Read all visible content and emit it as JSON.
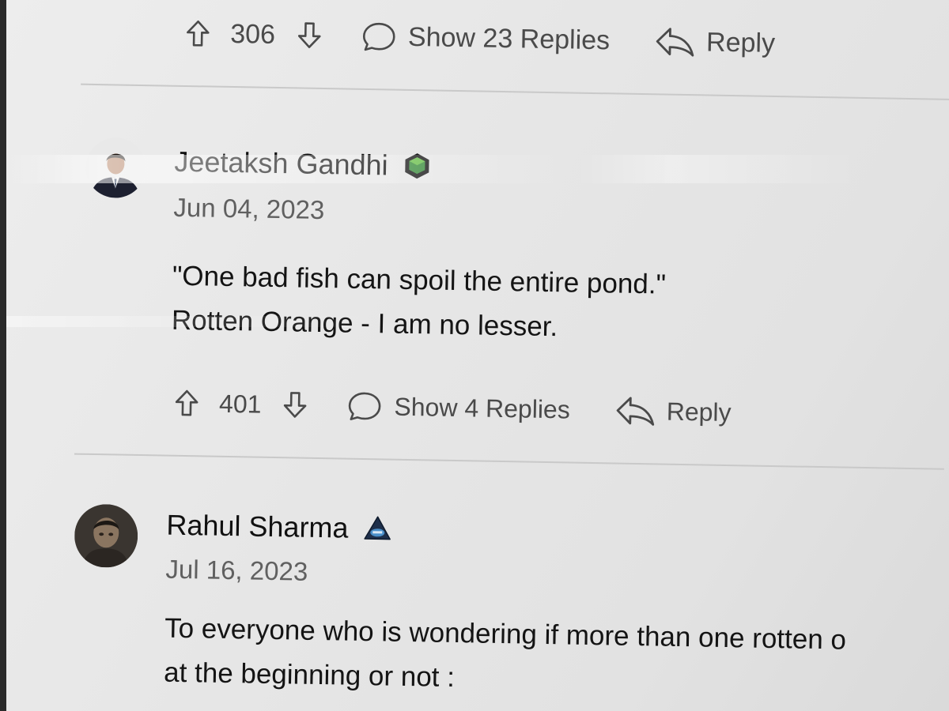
{
  "comments": [
    {
      "upvotes": "306",
      "replies_label": "Show 23 Replies",
      "reply_label": "Reply"
    },
    {
      "author": "Jeetaksh Gandhi",
      "badge_icon": "green-cube-badge-icon",
      "date": "Jun 04, 2023",
      "body_line1": "\"One bad fish can spoil the entire pond.\"",
      "body_line2": "Rotten Orange - I am no lesser.",
      "upvotes": "401",
      "replies_label": "Show 4 Replies",
      "reply_label": "Reply"
    },
    {
      "author": "Rahul Sharma",
      "badge_icon": "blue-rank-badge-icon",
      "date": "Jul 16, 2023",
      "body_line1": "To everyone who is wondering if more than one rotten o",
      "body_line2": "at the beginning or not :"
    }
  ],
  "colors": {
    "text_primary": "#111111",
    "text_secondary": "#606060",
    "icon": "#4a4a4a",
    "divider": "#c9c9c9",
    "badge_green": "#2e7d32",
    "badge_blue": "#1e3a5f"
  }
}
